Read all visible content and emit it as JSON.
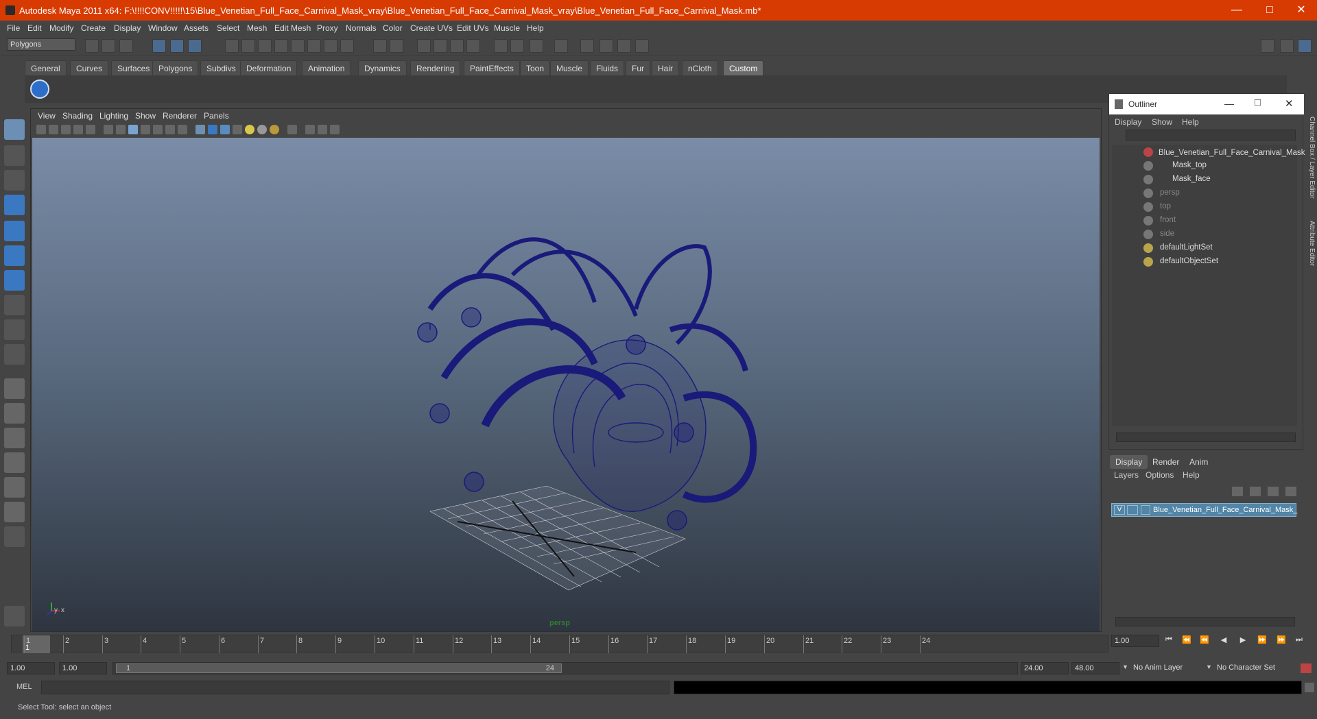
{
  "window": {
    "title": "Autodesk Maya 2011 x64: F:\\!!!!CONV!!!!!\\15\\Blue_Venetian_Full_Face_Carnival_Mask_vray\\Blue_Venetian_Full_Face_Carnival_Mask_vray\\Blue_Venetian_Full_Face_Carnival_Mask.mb*"
  },
  "menubar": [
    "File",
    "Edit",
    "Modify",
    "Create",
    "Display",
    "Window",
    "Assets",
    "Select",
    "Mesh",
    "Edit Mesh",
    "Proxy",
    "Normals",
    "Color",
    "Create UVs",
    "Edit UVs",
    "Muscle",
    "Help"
  ],
  "mode_selector": "Polygons",
  "shelf_tabs": [
    "General",
    "Curves",
    "Surfaces",
    "Polygons",
    "Subdivs",
    "Deformation",
    "Animation",
    "Dynamics",
    "Rendering",
    "PaintEffects",
    "Toon",
    "Muscle",
    "Fluids",
    "Fur",
    "Hair",
    "nCloth",
    "Custom"
  ],
  "active_shelf_tab": "Custom",
  "panel_menu": [
    "View",
    "Shading",
    "Lighting",
    "Show",
    "Renderer",
    "Panels"
  ],
  "viewport": {
    "camera_label": "persp",
    "axis_x": "x",
    "axis_y": "y",
    "wire_color": "#1a1a7a"
  },
  "outliner": {
    "title": "Outliner",
    "menu": [
      "Display",
      "Show",
      "Help"
    ],
    "items": [
      {
        "label": "Blue_Venetian_Full_Face_Carnival_Mask",
        "dim": false
      },
      {
        "label": "Mask_top",
        "dim": false
      },
      {
        "label": "Mask_face",
        "dim": false
      },
      {
        "label": "persp",
        "dim": true
      },
      {
        "label": "top",
        "dim": true
      },
      {
        "label": "front",
        "dim": true
      },
      {
        "label": "side",
        "dim": true
      },
      {
        "label": "defaultLightSet",
        "dim": false
      },
      {
        "label": "defaultObjectSet",
        "dim": false
      }
    ]
  },
  "side_tabs": [
    "Channel Box / Layer Editor",
    "Attribute Editor"
  ],
  "layer_editor": {
    "tabs": [
      "Display",
      "Render",
      "Anim"
    ],
    "menu": [
      "Layers",
      "Options",
      "Help"
    ],
    "layer_v": "V",
    "layer_name": "Blue_Venetian_Full_Face_Carnival_Mask_"
  },
  "timeline": {
    "ticks": [
      "1",
      "2",
      "3",
      "4",
      "5",
      "6",
      "7",
      "8",
      "9",
      "10",
      "11",
      "12",
      "13",
      "14",
      "15",
      "16",
      "17",
      "18",
      "19",
      "20",
      "21",
      "22",
      "23",
      "24"
    ],
    "current_frame": "1",
    "current_time": "1.00"
  },
  "range": {
    "start": "1.00",
    "playback_start": "1.00",
    "slider_start": "1",
    "slider_end": "24",
    "playback_end": "24.00",
    "end": "48.00",
    "anim_layer": "No Anim Layer",
    "char_set": "No Character Set"
  },
  "command": {
    "label": "MEL"
  },
  "help_line": "Select Tool: select an object"
}
